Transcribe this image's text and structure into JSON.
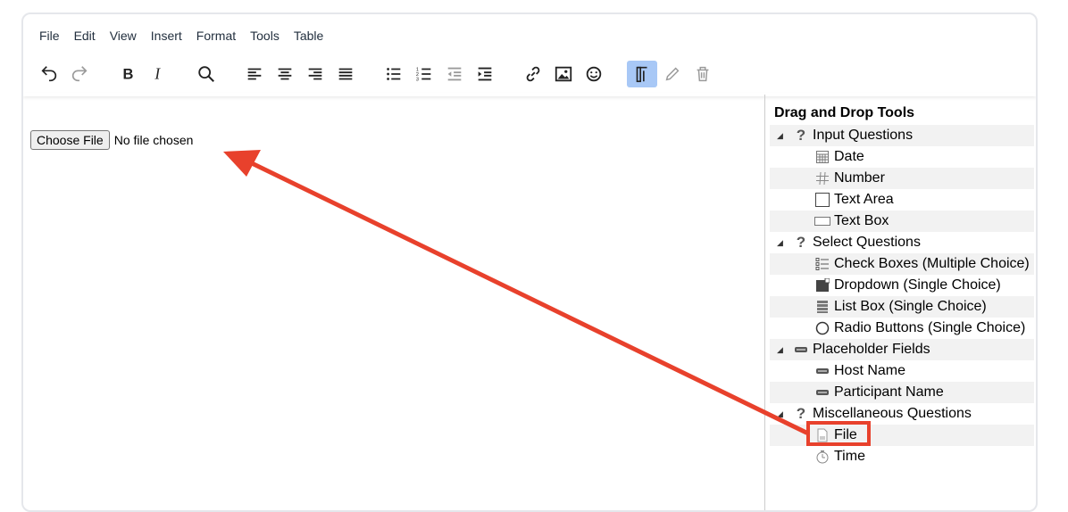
{
  "menubar": {
    "items": [
      "File",
      "Edit",
      "View",
      "Insert",
      "Format",
      "Tools",
      "Table"
    ]
  },
  "toolbar": {
    "icons": [
      "undo-icon",
      "redo-icon",
      "bold-icon",
      "italic-icon",
      "search-icon",
      "align-left-icon",
      "align-center-icon",
      "align-right-icon",
      "justify-icon",
      "bullet-list-icon",
      "numbered-list-icon",
      "outdent-icon",
      "indent-icon",
      "link-icon",
      "image-icon",
      "emoji-icon",
      "template-icon",
      "edit-icon",
      "delete-icon"
    ],
    "active": "template-icon"
  },
  "editor": {
    "file_button": "Choose File",
    "file_status": "No file chosen"
  },
  "sidebar": {
    "title": "Drag and Drop Tools",
    "groups": [
      {
        "label": "Input Questions",
        "icon": "question-icon",
        "items": [
          {
            "label": "Date",
            "icon": "calendar-grid-icon"
          },
          {
            "label": "Number",
            "icon": "hash-icon"
          },
          {
            "label": "Text Area",
            "icon": "textarea-icon"
          },
          {
            "label": "Text Box",
            "icon": "textbox-icon"
          }
        ]
      },
      {
        "label": "Select Questions",
        "icon": "question-icon",
        "items": [
          {
            "label": "Check Boxes (Multiple Choice)",
            "icon": "checklist-icon"
          },
          {
            "label": "Dropdown (Single Choice)",
            "icon": "dropdown-icon"
          },
          {
            "label": "List Box (Single Choice)",
            "icon": "listbox-icon"
          },
          {
            "label": "Radio Buttons (Single Choice)",
            "icon": "radio-icon"
          }
        ]
      },
      {
        "label": "Placeholder Fields",
        "icon": "placeholder-icon",
        "items": [
          {
            "label": "Host Name",
            "icon": "placeholder-icon"
          },
          {
            "label": "Participant Name",
            "icon": "placeholder-icon"
          }
        ]
      },
      {
        "label": "Miscellaneous Questions",
        "icon": "question-icon",
        "items": [
          {
            "label": "File",
            "icon": "file-icon"
          },
          {
            "label": "Time",
            "icon": "clock-icon"
          }
        ]
      }
    ]
  },
  "annotation": {
    "color": "#e8412c"
  }
}
